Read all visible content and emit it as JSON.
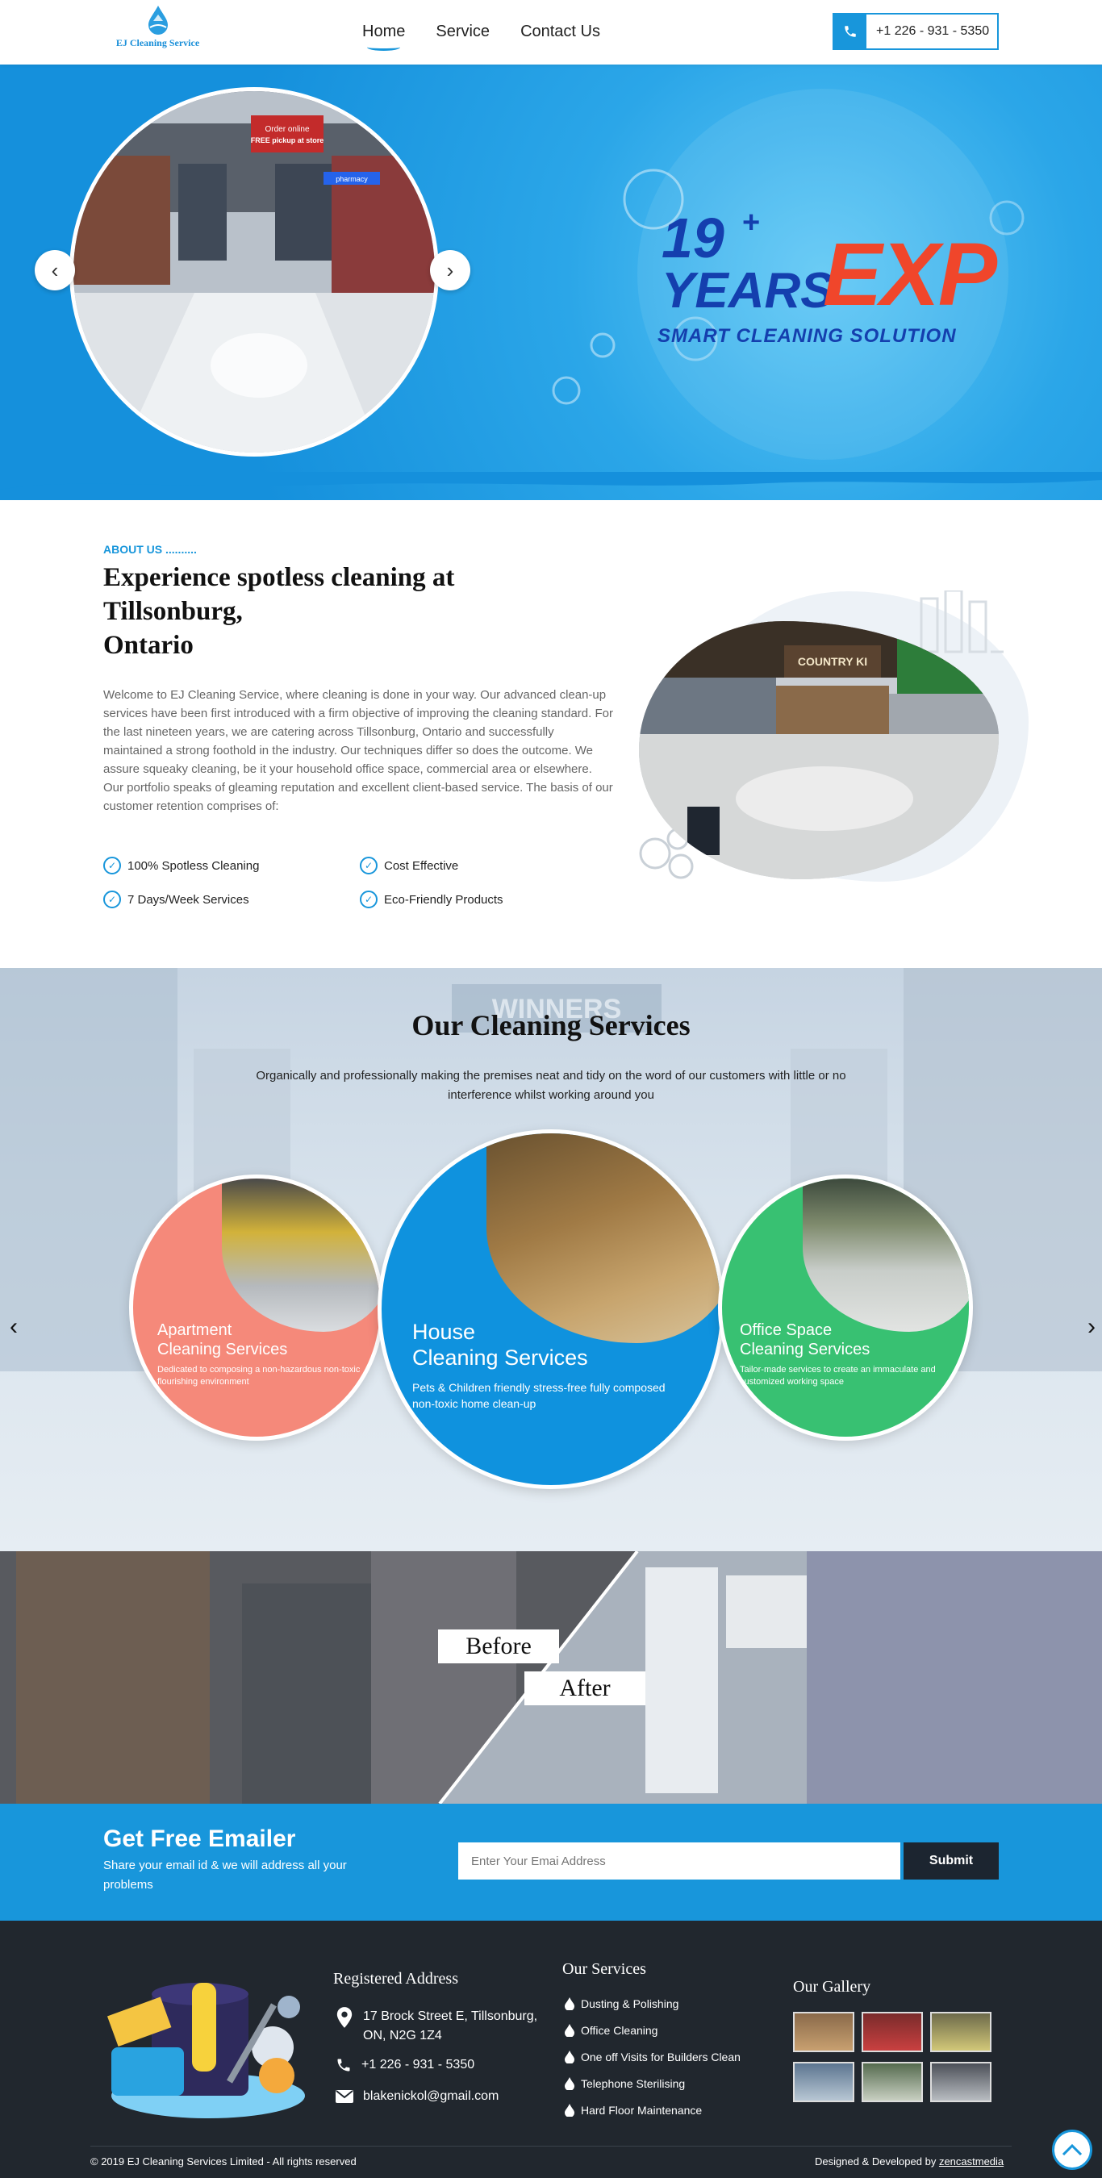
{
  "header": {
    "logo_text": "EJ Cleaning Service",
    "nav": [
      {
        "label": "Home",
        "active": true
      },
      {
        "label": "Service",
        "active": false
      },
      {
        "label": "Contact Us",
        "active": false
      }
    ],
    "phone": "+1 226 - 931 - 5350",
    "accent_color": "#1896db"
  },
  "hero": {
    "prev_arrow": "‹",
    "next_arrow": "›",
    "exp_19": "19",
    "exp_plus": "+",
    "exp_years": "YEARS",
    "exp_exp": "EXP",
    "exp_smart": "SMART CLEANING SOLUTION",
    "store_sign_1": "Order online",
    "store_sign_2": "FREE pickup at store",
    "store_sign_3": "pharmacy"
  },
  "about": {
    "tag": "ABOUT US ..........",
    "title_line1": "Experience spotless cleaning at",
    "title_line2": "Tillsonburg,",
    "title_line3": "Ontario",
    "paragraph1": "Welcome to EJ Cleaning Service, where cleaning is done in your way. Our advanced clean-up services have been first introduced with a firm objective of improving the cleaning standard. For the last nineteen years, we are catering across Tillsonburg, Ontario and successfully maintained a strong foothold in the industry. Our techniques differ so does the outcome. We assure squeaky cleaning, be it your household office space, commercial area or elsewhere.",
    "paragraph2": "Our portfolio speaks of gleaming reputation and excellent client-based service. The basis of our customer retention comprises of:",
    "checks": [
      "100% Spotless Cleaning",
      "Cost Effective",
      "7 Days/Week Services",
      "Eco-Friendly Products"
    ],
    "store_sign": "COUNTRY KI"
  },
  "services": {
    "title": "Our Cleaning Services",
    "subtitle": "Organically and professionally making the premises neat and tidy on the word of our customers with little or no interference whilst working around you",
    "bg_sign": "WINNERS",
    "cards": [
      {
        "title1": "Apartment",
        "title2": "Cleaning Services",
        "desc": "Dedicated to composing a non-hazardous non-toxic flourishing environment",
        "color": "#f5897a"
      },
      {
        "title1": "House",
        "title2": "Cleaning Services",
        "desc": "Pets & Children friendly stress-free fully composed non-toxic home clean-up",
        "color": "#0f92de"
      },
      {
        "title1": "Office Space",
        "title2": "Cleaning Services",
        "desc": "Tailor-made services to create an immaculate and customized working space",
        "color": "#38c172"
      }
    ],
    "prev_arrow": "‹",
    "next_arrow": "›"
  },
  "before_after": {
    "before": "Before",
    "after": "After"
  },
  "emailer": {
    "title": "Get Free Emailer",
    "subtitle": "Share your email id & we will address all your problems",
    "placeholder": "Enter Your Emai Address",
    "button": "Submit"
  },
  "footer": {
    "address_heading": "Registered Address",
    "address_line1": "17 Brock Street E, Tillsonburg,",
    "address_line2": "ON, N2G 1Z4",
    "phone": "+1 226 - 931 - 5350",
    "email": "blakenickol@gmail.com",
    "services_heading": "Our Services",
    "services": [
      "Dusting & Polishing",
      "Office Cleaning",
      "One off Visits for Builders Clean",
      "Telephone Sterilising",
      "Hard Floor Maintenance"
    ],
    "gallery_heading": "Our Gallery",
    "copyright": "© 2019 EJ Cleaning Services Limited - All rights reserved",
    "designed_prefix": "Designed & Developed by ",
    "designed_link": "zencastmedia",
    "scroll_top": "^"
  }
}
